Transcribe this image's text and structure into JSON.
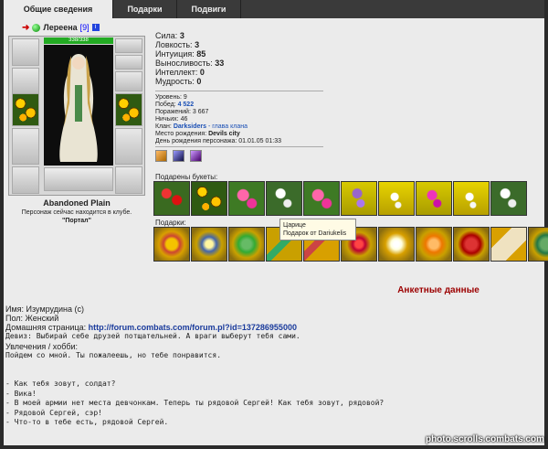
{
  "tabs": [
    {
      "label": "Общие сведения"
    },
    {
      "label": "Подарки"
    },
    {
      "label": "Подвиги"
    }
  ],
  "header": {
    "nick": "Лереена",
    "level": "[9]",
    "info_icon": "i"
  },
  "doll": {
    "hp_text": "338/338",
    "hp_fraction": 1.0
  },
  "location": {
    "name": "Abandoned Plain",
    "status_text": "Персонаж сейчас находится в клубе.",
    "room": "\"Портал\""
  },
  "stats": [
    {
      "label": "Сила:",
      "value": "3"
    },
    {
      "label": "Ловкость:",
      "value": "3"
    },
    {
      "label": "Интуиция:",
      "value": "85"
    },
    {
      "label": "Выносливость:",
      "value": "33"
    },
    {
      "label": "Интеллект:",
      "value": "0"
    },
    {
      "label": "Мудрость:",
      "value": "0"
    }
  ],
  "info": {
    "level": {
      "label": "Уровень:",
      "value": "9"
    },
    "wins": {
      "label": "Побед:",
      "value": "4 522"
    },
    "losses": {
      "label": "Поражений:",
      "value": "3 667"
    },
    "draws": {
      "label": "Ничьих:",
      "value": "46"
    },
    "clan": {
      "label": "Клан:",
      "name": "Darksiders",
      "role": "- глава клана"
    },
    "birthplace": {
      "label": "Место рождения:",
      "value": "Devils city"
    },
    "birthday": {
      "label": "День рождения персонажа:",
      "value": "01.01.05 01:33"
    }
  },
  "bouquets_label": "Подарены букеты:",
  "gifts_label": "Подарки:",
  "tooltip": {
    "title": "Царице",
    "from": "Подарок от Dariukelis"
  },
  "anket_title": "Анкетные данные",
  "profile": {
    "name": {
      "label": "Имя:",
      "value": "Изумрудина (с)"
    },
    "gender": {
      "label": "Пол:",
      "value": "Женский"
    },
    "homepage": {
      "label": "Домашняя страница:",
      "value": "http://forum.combats.com/forum.pl?id=1372869550​00"
    },
    "motto": {
      "label": "Девиз:",
      "value": "Выбирай себе друзей потщательней. А враги выберут тебя сами."
    },
    "hobby_label": "Увлечения / хобби:",
    "lines": [
      "Пойдем со мной. Ты пожалеешь, но тебе понравится.",
      "",
      "",
      "- Как тебя зовут, солдат?",
      "- Вика!",
      "- В моей армии нет места девчонкам. Теперь ты рядовой Сергей! Как тебя зовут, рядовой?",
      "- Рядовой Сергей, сэр!",
      "- Что-то в тебе есть, рядовой Сергей."
    ]
  },
  "watermark": "photo.scrolls.combats.com"
}
